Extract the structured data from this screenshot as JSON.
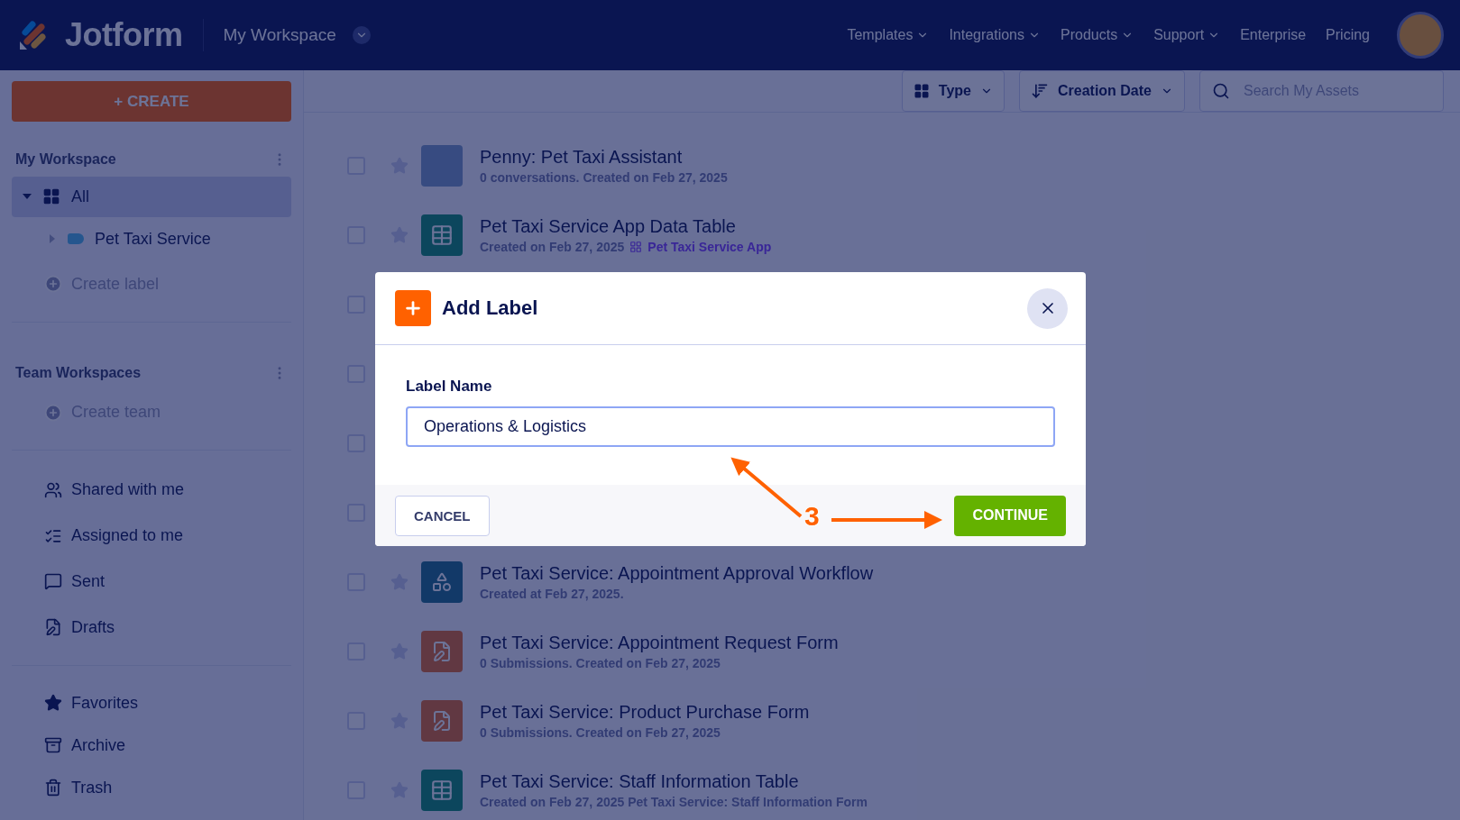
{
  "header": {
    "brand": "Jotform",
    "workspace": "My Workspace",
    "nav": [
      {
        "label": "Templates",
        "dropdown": true
      },
      {
        "label": "Integrations",
        "dropdown": true
      },
      {
        "label": "Products",
        "dropdown": true
      },
      {
        "label": "Support",
        "dropdown": true
      },
      {
        "label": "Enterprise",
        "dropdown": false
      },
      {
        "label": "Pricing",
        "dropdown": false
      }
    ]
  },
  "sidebar": {
    "create_button": "+ CREATE",
    "workspace": {
      "title": "My Workspace",
      "items": [
        {
          "label": "All",
          "selected": true,
          "expanded": true,
          "children": [
            {
              "label": "Pet Taxi Service",
              "selected": false,
              "expanded": false
            }
          ]
        }
      ],
      "create": "Create label"
    },
    "team": {
      "title": "Team Workspaces",
      "create": "Create team"
    },
    "nav": [
      {
        "label": "Shared with me"
      },
      {
        "label": "Assigned to me"
      },
      {
        "label": "Sent"
      },
      {
        "label": "Drafts"
      }
    ],
    "nav2": [
      {
        "label": "Favorites"
      },
      {
        "label": "Archive"
      },
      {
        "label": "Trash"
      }
    ]
  },
  "toolbar": {
    "type_filter": "Type",
    "sort": "Creation Date",
    "search": {
      "placeholder": "Search My Assets"
    }
  },
  "assets": [
    {
      "kind": "agent",
      "title": "Penny: Pet Taxi Assistant",
      "subtitle": "0 conversations. Created on Feb 27, 2025",
      "checked": false,
      "favorite": false
    },
    {
      "kind": "table",
      "title": "Pet Taxi Service App Data Table",
      "subtitle": "Created on Feb 27, 2025",
      "link": "Pet Taxi Service App",
      "checked": false,
      "favorite": false
    },
    {
      "kind": "covered",
      "checked": false
    },
    {
      "kind": "covered",
      "checked": false
    },
    {
      "kind": "covered",
      "checked": false
    },
    {
      "kind": "covered",
      "checked": false
    },
    {
      "kind": "workflow",
      "title": "Pet Taxi Service: Appointment Approval Workflow",
      "subtitle": "Created at Feb 27, 2025.",
      "checked": false,
      "favorite": false
    },
    {
      "kind": "form",
      "title": "Pet Taxi Service: Appointment Request Form",
      "subtitle": "0 Submissions. Created on Feb 27, 2025",
      "checked": false,
      "favorite": false
    },
    {
      "kind": "form",
      "title": "Pet Taxi Service: Product Purchase Form",
      "subtitle": "0 Submissions. Created on Feb 27, 2025",
      "checked": false,
      "favorite": false
    },
    {
      "kind": "table",
      "title": "Pet Taxi Service: Staff Information Table",
      "subtitle": "Created on Feb 27, 2025 Pet Taxi Service: Staff Information Form",
      "checked": false,
      "favorite": false
    }
  ],
  "modal": {
    "title": "Add Label",
    "field_label": "Label Name",
    "value": "Operations & Logistics",
    "cancel": "CANCEL",
    "continue": "CONTINUE"
  },
  "annotation": {
    "step": "3"
  }
}
